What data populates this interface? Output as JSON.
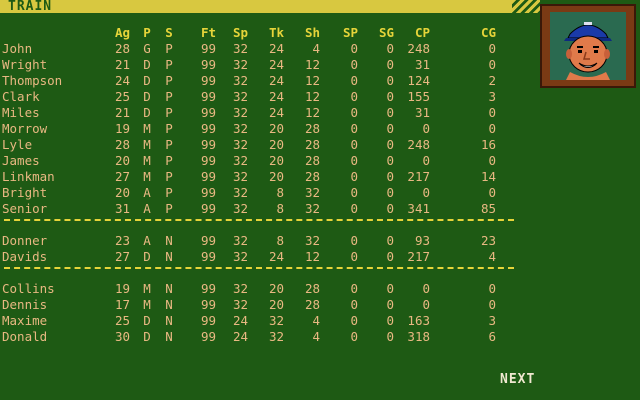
{
  "screen_title": "TRAIN",
  "headers": [
    "Ag",
    "P",
    "S",
    "Ft",
    "Sp",
    "Tk",
    "Sh",
    "SP",
    "SG",
    "CP",
    "CG"
  ],
  "groups": [
    [
      [
        "John",
        "28",
        "G",
        "P",
        "99",
        "32",
        "24",
        "4",
        "0",
        "0",
        "248",
        "0"
      ],
      [
        "Wright",
        "21",
        "D",
        "P",
        "99",
        "32",
        "24",
        "12",
        "0",
        "0",
        "31",
        "0"
      ],
      [
        "Thompson",
        "24",
        "D",
        "P",
        "99",
        "32",
        "24",
        "12",
        "0",
        "0",
        "124",
        "2"
      ],
      [
        "Clark",
        "25",
        "D",
        "P",
        "99",
        "32",
        "24",
        "12",
        "0",
        "0",
        "155",
        "3"
      ],
      [
        "Miles",
        "21",
        "D",
        "P",
        "99",
        "32",
        "24",
        "12",
        "0",
        "0",
        "31",
        "0"
      ],
      [
        "Morrow",
        "19",
        "M",
        "P",
        "99",
        "32",
        "20",
        "28",
        "0",
        "0",
        "0",
        "0"
      ],
      [
        "Lyle",
        "28",
        "M",
        "P",
        "99",
        "32",
        "20",
        "28",
        "0",
        "0",
        "248",
        "16"
      ],
      [
        "James",
        "20",
        "M",
        "P",
        "99",
        "32",
        "20",
        "28",
        "0",
        "0",
        "0",
        "0"
      ],
      [
        "Linkman",
        "27",
        "M",
        "P",
        "99",
        "32",
        "20",
        "28",
        "0",
        "0",
        "217",
        "14"
      ],
      [
        "Bright",
        "20",
        "A",
        "P",
        "99",
        "32",
        "8",
        "32",
        "0",
        "0",
        "0",
        "0"
      ],
      [
        "Senior",
        "31",
        "A",
        "P",
        "99",
        "32",
        "8",
        "32",
        "0",
        "0",
        "341",
        "85"
      ]
    ],
    [
      [
        "Donner",
        "23",
        "A",
        "N",
        "99",
        "32",
        "8",
        "32",
        "0",
        "0",
        "93",
        "23"
      ],
      [
        "Davids",
        "27",
        "D",
        "N",
        "99",
        "32",
        "24",
        "12",
        "0",
        "0",
        "217",
        "4"
      ]
    ],
    [
      [
        "Collins",
        "19",
        "M",
        "N",
        "99",
        "32",
        "20",
        "28",
        "0",
        "0",
        "0",
        "0"
      ],
      [
        "Dennis",
        "17",
        "M",
        "N",
        "99",
        "32",
        "20",
        "28",
        "0",
        "0",
        "0",
        "0"
      ],
      [
        "Maxime",
        "25",
        "D",
        "N",
        "99",
        "24",
        "32",
        "4",
        "0",
        "0",
        "163",
        "3"
      ],
      [
        "Donald",
        "30",
        "D",
        "N",
        "99",
        "24",
        "32",
        "4",
        "0",
        "0",
        "318",
        "6"
      ]
    ]
  ],
  "next_label": "NEXT",
  "portrait_icon": "player-face-icon",
  "colors": {
    "background": "#1e5a14",
    "header_text": "#e6d43a",
    "row_text": "#e8b882",
    "title_bar": "#d8c840",
    "portrait_frame": "#7a3a14"
  }
}
